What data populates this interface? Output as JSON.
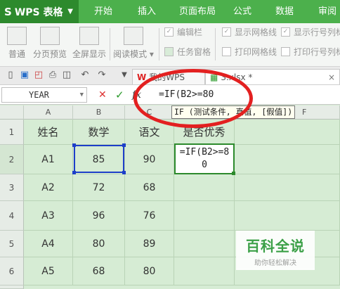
{
  "app": {
    "logo_glyph": "S",
    "name": "WPS 表格",
    "dropdown": "▼"
  },
  "menus": [
    "开始",
    "插入",
    "页面布局",
    "公式",
    "数据",
    "审阅"
  ],
  "ribbon": {
    "buttons": [
      "普通",
      "分页预览",
      "全屏显示",
      "阅读模式 ▾"
    ],
    "checks": [
      {
        "label": "编辑栏",
        "checked": true
      },
      {
        "label": "任务窗格",
        "checked": false
      },
      {
        "label": "显示网格线",
        "checked": true
      },
      {
        "label": "打印网格线",
        "checked": false
      },
      {
        "label": "显示行号列标",
        "checked": true
      },
      {
        "label": "打印行号列标",
        "checked": false
      }
    ]
  },
  "tabs": [
    {
      "label": "我的WPS",
      "icon": "wps-logo-icon"
    },
    {
      "label": "3.xlsx *",
      "icon": "sheet-file-icon"
    }
  ],
  "tab_close": "×",
  "formula_bar": {
    "name_box": "YEAR",
    "cancel": "✕",
    "confirm": "✓",
    "fx": "fx",
    "formula": "=IF(B2>=80",
    "tooltip": "IF (测试条件, 真值, [假值])"
  },
  "columns": [
    "A",
    "B",
    "C",
    "D",
    "F"
  ],
  "rows": [
    "1",
    "2",
    "3",
    "4",
    "5",
    "6"
  ],
  "table": {
    "header": [
      "姓名",
      "数学",
      "语文",
      "是否优秀"
    ],
    "data": [
      [
        "A1",
        "85",
        "90",
        "=IF(B2>=8\n0"
      ],
      [
        "A2",
        "72",
        "68",
        ""
      ],
      [
        "A3",
        "96",
        "76",
        ""
      ],
      [
        "A4",
        "80",
        "89",
        ""
      ],
      [
        "A5",
        "68",
        "80",
        ""
      ]
    ]
  },
  "watermark": {
    "title": "百科全说",
    "subtitle": "助你轻松解决"
  },
  "colors": {
    "title_green": "#4cb04c",
    "selection_blue": "#1d3fc9",
    "annotation_red": "#e32020",
    "sheet_bg": "#d6ecd4"
  }
}
